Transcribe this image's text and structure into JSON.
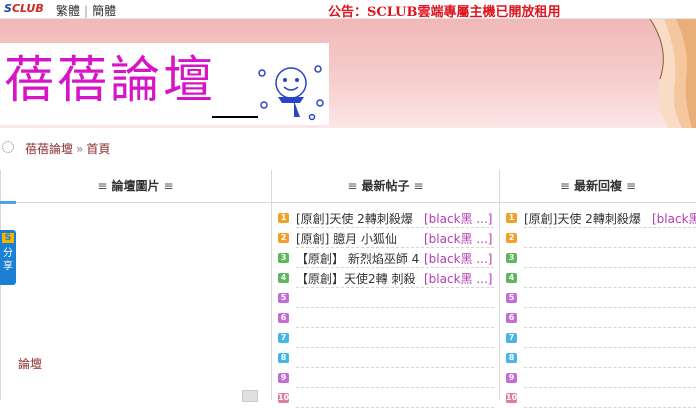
{
  "topbar": {
    "brand_prefix": "S",
    "brand_rest": "CLUB",
    "lang_trad": "繁體",
    "lang_simp": "簡體",
    "announcement": "公告：SCLUB雲端專屬主機已開放租用"
  },
  "banner": {
    "logo_text": "蓓蓓論壇"
  },
  "breadcrumb": {
    "forum": "蓓蓓論壇",
    "arrow": "»",
    "home": "首頁"
  },
  "columns": {
    "pics_header": "論壇圖片",
    "posts_header": "最新帖子",
    "replies_header": "最新回複",
    "bar": "≡"
  },
  "pics": {
    "label": "論壇"
  },
  "share": {
    "mark": "S",
    "text": "分享"
  },
  "colors": {
    "badge": [
      "#f0a12a",
      "#f0a12a",
      "#5cb85c",
      "#5cb85c",
      "#c36bd6",
      "#c36bd6",
      "#45b6e8",
      "#45b6e8",
      "#c36bd6",
      "#e07aa6"
    ]
  },
  "posts": [
    {
      "num": "1",
      "title": "[原創]天使 2轉刺殺爆",
      "author": "[black黑 ...]"
    },
    {
      "num": "2",
      "title": "[原創] 臆月 小狐仙",
      "author": "[black黑 ...]"
    },
    {
      "num": "3",
      "title": "【原創】 新烈焰巫師 4",
      "author": "[black黑 ...]"
    },
    {
      "num": "4",
      "title": "【原創】天使2轉 刺殺",
      "author": "[black黑 ...]"
    },
    {
      "num": "5",
      "title": "",
      "author": ""
    },
    {
      "num": "6",
      "title": "",
      "author": ""
    },
    {
      "num": "7",
      "title": "",
      "author": ""
    },
    {
      "num": "8",
      "title": "",
      "author": ""
    },
    {
      "num": "9",
      "title": "",
      "author": ""
    },
    {
      "num": "10",
      "title": "",
      "author": ""
    }
  ],
  "replies": [
    {
      "num": "1",
      "title": "[原創]天使 2轉刺殺爆",
      "author": "[black黑"
    },
    {
      "num": "2",
      "title": "",
      "author": ""
    },
    {
      "num": "3",
      "title": "",
      "author": ""
    },
    {
      "num": "4",
      "title": "",
      "author": ""
    },
    {
      "num": "5",
      "title": "",
      "author": ""
    },
    {
      "num": "6",
      "title": "",
      "author": ""
    },
    {
      "num": "7",
      "title": "",
      "author": ""
    },
    {
      "num": "8",
      "title": "",
      "author": ""
    },
    {
      "num": "9",
      "title": "",
      "author": ""
    },
    {
      "num": "10",
      "title": "",
      "author": ""
    }
  ]
}
